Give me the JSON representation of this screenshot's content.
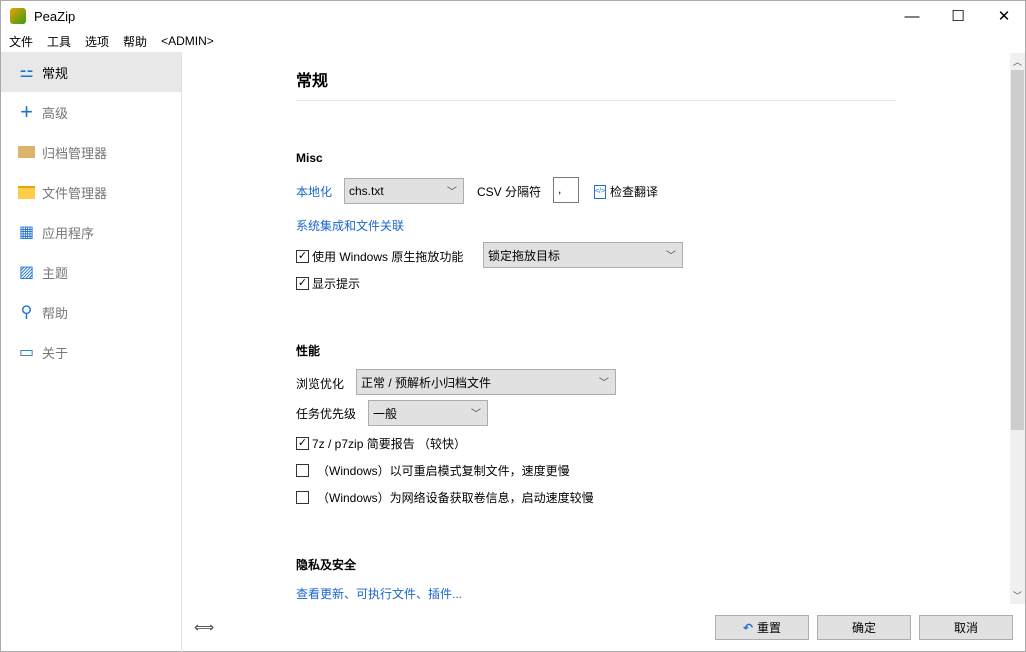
{
  "window": {
    "title": "PeaZip",
    "minimize": "—",
    "maximize": "☐",
    "close": "✕"
  },
  "menu": [
    "文件",
    "工具",
    "选项",
    "帮助",
    "<ADMIN>"
  ],
  "sidebar": [
    {
      "label": "常规",
      "icon": "sliders-icon"
    },
    {
      "label": "高级",
      "icon": "plus-icon"
    },
    {
      "label": "归档管理器",
      "icon": "archive-icon"
    },
    {
      "label": "文件管理器",
      "icon": "folder-icon"
    },
    {
      "label": "应用程序",
      "icon": "grid-icon"
    },
    {
      "label": "主题",
      "icon": "image-icon"
    },
    {
      "label": "帮助",
      "icon": "search-icon"
    },
    {
      "label": "关于",
      "icon": "chat-icon"
    }
  ],
  "page_title": "常规",
  "misc": {
    "heading": "Misc",
    "localization_label": "本地化",
    "localization_value": "chs.txt",
    "csv_label": "CSV 分隔符",
    "csv_value": ",",
    "check_translation": "检查翻译",
    "system_integration": "系统集成和文件关联",
    "native_drag": "使用 Windows 原生拖放功能",
    "native_drag_checked": true,
    "drag_option": "锁定拖放目标",
    "show_hints": "显示提示",
    "show_hints_checked": true
  },
  "performance": {
    "heading": "性能",
    "browse_label": "浏览优化",
    "browse_value": "正常 / 预解析小归档文件",
    "priority_label": "任务优先级",
    "priority_value": "一般",
    "report": "7z / p7zip 简要报告 （较快）",
    "report_checked": true,
    "restart_copy": "（Windows）以可重启模式复制文件，速度更慢",
    "restart_copy_checked": false,
    "network_info": "（Windows）为网络设备获取卷信息，启动速度较慢",
    "network_info_checked": false
  },
  "privacy": {
    "heading": "隐私及安全",
    "updates_link": "查看更新、可执行文件、插件..."
  },
  "buttons": {
    "reset": "重置",
    "ok": "确定",
    "cancel": "取消"
  }
}
